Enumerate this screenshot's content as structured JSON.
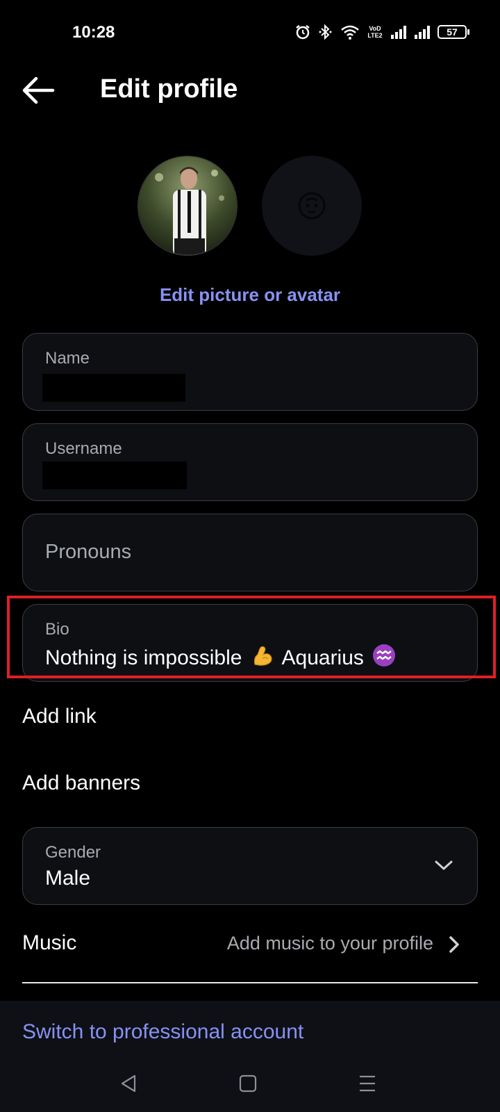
{
  "status_bar": {
    "time": "10:28",
    "network_label": "VoD LTE2",
    "battery": "57"
  },
  "header": {
    "title": "Edit profile"
  },
  "avatar": {
    "edit_link": "Edit picture or avatar"
  },
  "fields": {
    "name": {
      "label": "Name",
      "value": ""
    },
    "username": {
      "label": "Username",
      "value": ""
    },
    "pronouns": {
      "label": "Pronouns"
    },
    "bio": {
      "label": "Bio",
      "text_1": "Nothing is impossible",
      "text_2": "Aquarius"
    },
    "gender": {
      "label": "Gender",
      "value": "Male"
    }
  },
  "links": {
    "add_link": "Add link",
    "add_banners": "Add banners"
  },
  "music": {
    "label": "Music",
    "hint": "Add music to your profile"
  },
  "footer": {
    "professional_link": "Switch to professional account"
  },
  "colors": {
    "accent": "#8891f2",
    "highlight": "#e01f27",
    "field_border": "#3b3e45",
    "background": "#000000"
  },
  "icons": {
    "back": "arrow-left-icon",
    "alarm": "alarm-icon",
    "bluetooth": "bluetooth-icon",
    "wifi": "wifi-icon",
    "signal": "signal-icon",
    "avatar_placeholder": "avatar-face-icon",
    "flexed_biceps": "flexed-biceps-emoji",
    "aquarius": "aquarius-emoji",
    "dropdown": "chevron-down-icon",
    "music_chevron": "chevron-right-icon",
    "nav_back": "nav-back-triangle-icon",
    "nav_home": "nav-home-square-icon",
    "nav_menu": "nav-menu-lines-icon"
  }
}
